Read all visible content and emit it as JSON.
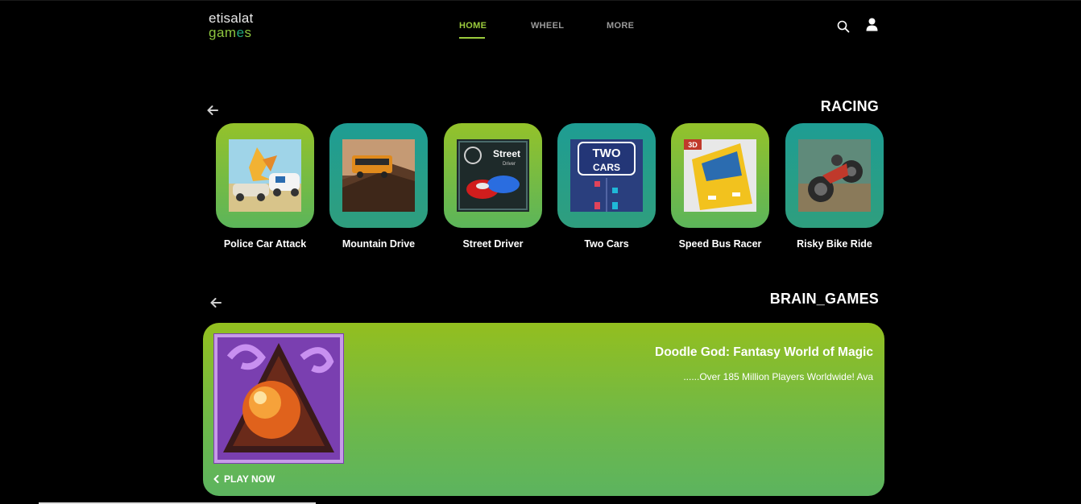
{
  "brand": {
    "line1": "etisalat",
    "line2_a": "gam",
    "line2_b": "e",
    "line2_c": "s"
  },
  "nav": {
    "items": [
      {
        "label": "HOME"
      },
      {
        "label": "WHEEL"
      },
      {
        "label": "MORE"
      }
    ],
    "active": "HOME"
  },
  "header_icons": [
    "search-icon",
    "user-icon"
  ],
  "sections": [
    {
      "title": "RACING",
      "games": [
        {
          "name": "Police Car Attack",
          "tile": "green"
        },
        {
          "name": "Mountain Drive",
          "tile": "teal"
        },
        {
          "name": "Street Driver",
          "tile": "green",
          "thumb_text": [
            "Street",
            "Driver"
          ]
        },
        {
          "name": "Two Cars",
          "tile": "teal",
          "thumb_text": [
            "TWO",
            "CARS"
          ]
        },
        {
          "name": "Speed Bus Racer",
          "tile": "green",
          "thumb_badge": "3D"
        },
        {
          "name": "Risky Bike Ride",
          "tile": "teal"
        }
      ]
    },
    {
      "title": "BRAIN_GAMES",
      "featured": {
        "title": "Doodle God: Fantasy World of Magic",
        "description": "......Over 185 Million Players Worldwide! Ava",
        "cta": "PLAY NOW"
      }
    }
  ],
  "colors": {
    "accent": "#9bcb3c",
    "tile_green": "#94c22a",
    "tile_teal": "#1e9d93",
    "background": "#000000"
  }
}
